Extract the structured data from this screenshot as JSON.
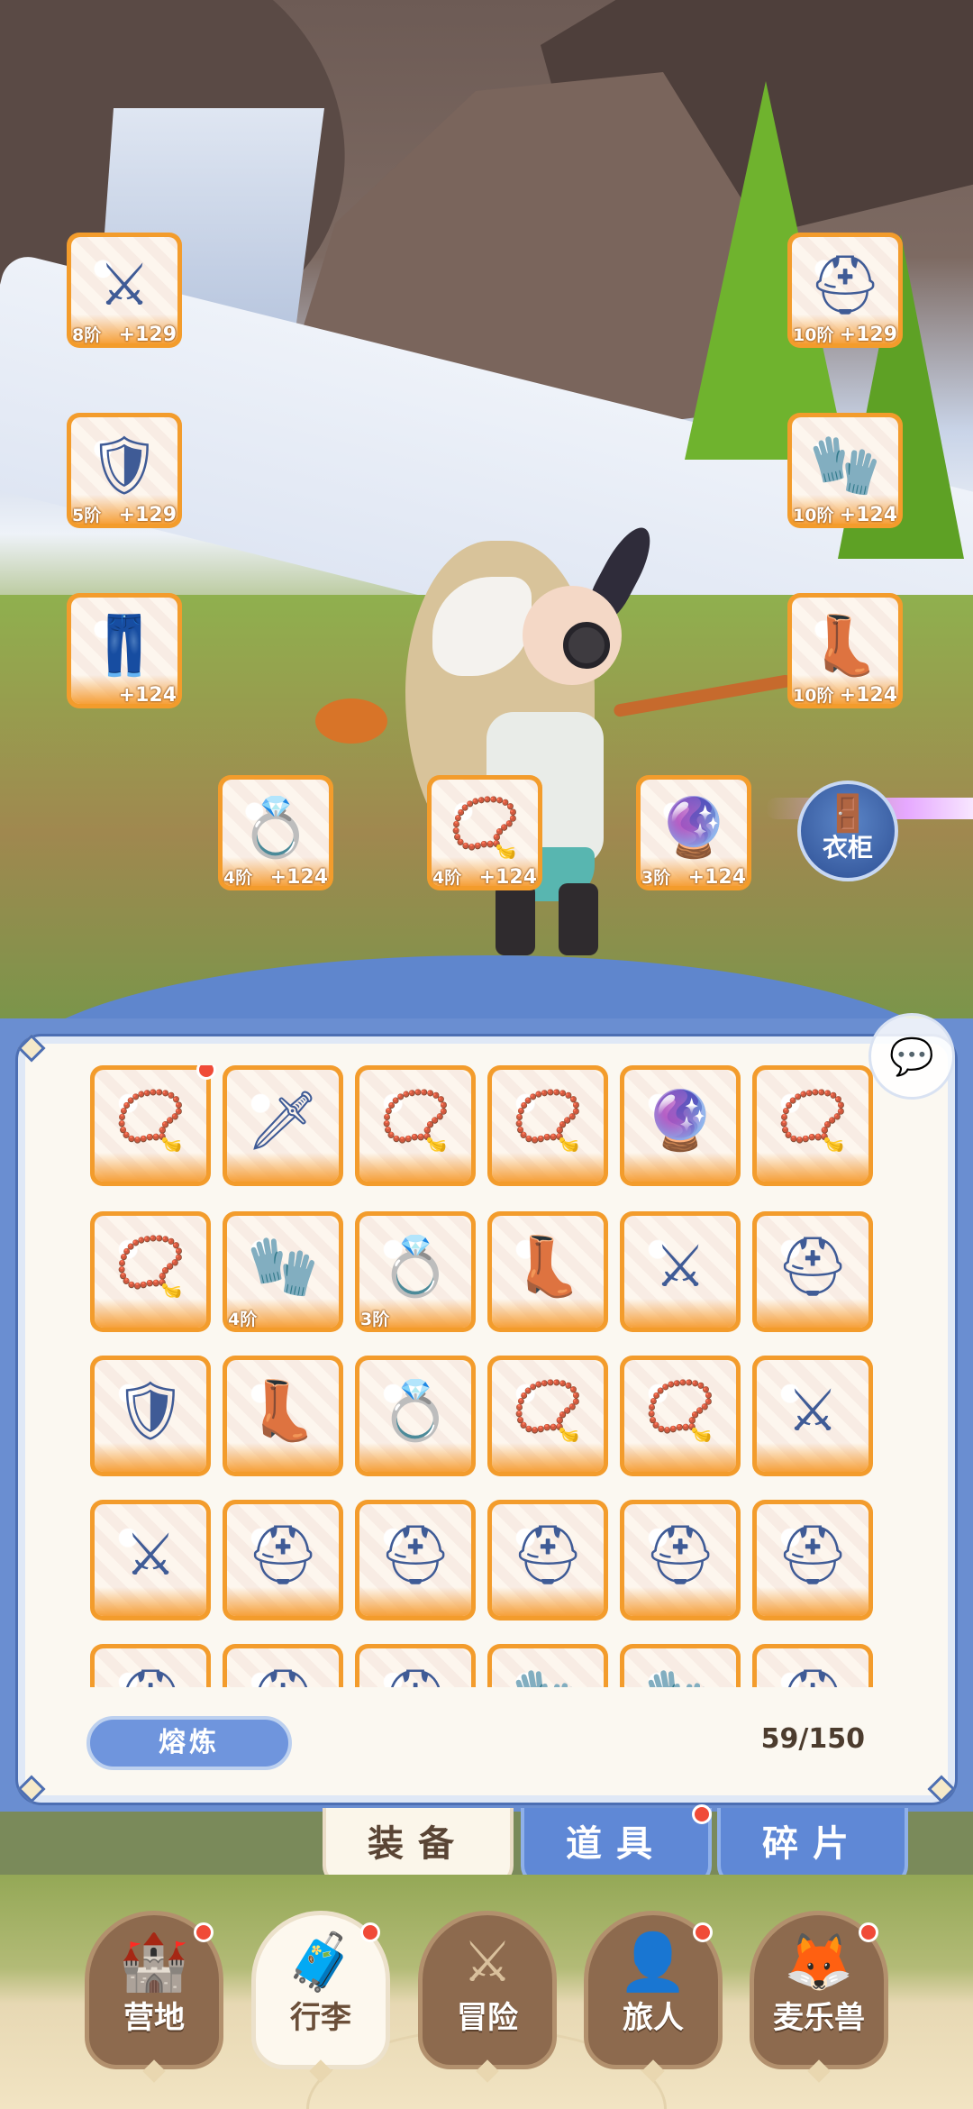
{
  "equipped": [
    {
      "slot": "weapon",
      "icon": "⚔",
      "tier": "8阶",
      "bonus": "+129"
    },
    {
      "slot": "helmet",
      "icon": "⛑",
      "tier": "10阶",
      "bonus": "+129"
    },
    {
      "slot": "armor",
      "icon": "🛡",
      "tier": "5阶",
      "bonus": "+129"
    },
    {
      "slot": "bracer",
      "icon": "🧤",
      "tier": "10阶",
      "bonus": "+124"
    },
    {
      "slot": "pants",
      "icon": "👖",
      "tier": "",
      "bonus": "+124"
    },
    {
      "slot": "boots",
      "icon": "👢",
      "tier": "10阶",
      "bonus": "+124"
    },
    {
      "slot": "ring",
      "icon": "💍",
      "tier": "4阶",
      "bonus": "+124"
    },
    {
      "slot": "necklace",
      "icon": "📿",
      "tier": "4阶",
      "bonus": "+124"
    },
    {
      "slot": "charm",
      "icon": "🔮",
      "tier": "3阶",
      "bonus": "+124"
    }
  ],
  "wardrobe": {
    "label": "衣柜",
    "icon": "wardrobe-icon"
  },
  "inventory": {
    "items": [
      {
        "icon": "📿",
        "tier": "",
        "new": true
      },
      {
        "icon": "🗡",
        "tier": "",
        "new": false
      },
      {
        "icon": "📿",
        "tier": "",
        "new": false
      },
      {
        "icon": "📿",
        "tier": "",
        "new": false
      },
      {
        "icon": "🔮",
        "tier": "",
        "new": false
      },
      {
        "icon": "📿",
        "tier": "",
        "new": false
      },
      {
        "icon": "📿",
        "tier": "",
        "new": false
      },
      {
        "icon": "🧤",
        "tier": "4阶",
        "new": false
      },
      {
        "icon": "💍",
        "tier": "3阶",
        "new": false
      },
      {
        "icon": "👢",
        "tier": "",
        "new": false
      },
      {
        "icon": "⚔",
        "tier": "",
        "new": false
      },
      {
        "icon": "⛑",
        "tier": "",
        "new": false
      },
      {
        "icon": "🛡",
        "tier": "",
        "new": false
      },
      {
        "icon": "👢",
        "tier": "",
        "new": false
      },
      {
        "icon": "💍",
        "tier": "",
        "new": false
      },
      {
        "icon": "📿",
        "tier": "",
        "new": false
      },
      {
        "icon": "📿",
        "tier": "",
        "new": false
      },
      {
        "icon": "⚔",
        "tier": "",
        "new": false
      },
      {
        "icon": "⚔",
        "tier": "",
        "new": false
      },
      {
        "icon": "⛑",
        "tier": "",
        "new": false
      },
      {
        "icon": "⛑",
        "tier": "",
        "new": false
      },
      {
        "icon": "⛑",
        "tier": "",
        "new": false
      },
      {
        "icon": "⛑",
        "tier": "",
        "new": false
      },
      {
        "icon": "⛑",
        "tier": "",
        "new": false
      },
      {
        "icon": "⛑",
        "tier": "",
        "new": false
      },
      {
        "icon": "⛑",
        "tier": "",
        "new": false
      },
      {
        "icon": "⛑",
        "tier": "",
        "new": false
      },
      {
        "icon": "🧤",
        "tier": "",
        "new": false
      },
      {
        "icon": "🧤",
        "tier": "",
        "new": false
      },
      {
        "icon": "⛑",
        "tier": "",
        "new": false
      }
    ],
    "smelt_label": "熔炼",
    "capacity": "59/150"
  },
  "tabs": [
    {
      "label": "装备",
      "active": true,
      "badge": false
    },
    {
      "label": "道具",
      "active": false,
      "badge": true
    },
    {
      "label": "碎片",
      "active": false,
      "badge": false
    }
  ],
  "nav": [
    {
      "label": "营地",
      "icon": "🏰",
      "badge": true,
      "active": false
    },
    {
      "label": "行李",
      "icon": "🧳",
      "badge": true,
      "active": true
    },
    {
      "label": "冒险",
      "icon": "⚔",
      "badge": false,
      "active": false
    },
    {
      "label": "旅人",
      "icon": "👤",
      "badge": true,
      "active": false
    },
    {
      "label": "麦乐兽",
      "icon": "🦊",
      "badge": true,
      "active": false
    }
  ],
  "colors": {
    "slot_orange": "#f39c2c",
    "panel_blue": "#6a8ed1",
    "badge_red": "#f04b38",
    "nav_brown": "#8d6a4e"
  }
}
